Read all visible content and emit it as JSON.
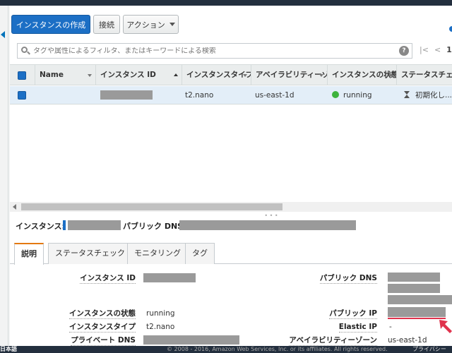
{
  "toolbar": {
    "create_instance": "インスタンスの作成",
    "connect": "接続",
    "actions": "アクション"
  },
  "search": {
    "placeholder": "タグや属性によるフィルタ、またはキーワードによる検索",
    "help": "?"
  },
  "pager": {
    "first": "|<",
    "prev": "<",
    "page": "1"
  },
  "table": {
    "columns": [
      "Name",
      "インスタンス ID",
      "インスタンスタイプ",
      "アベイラビリティーゾーン",
      "インスタンスの状態",
      "ステータスチェック"
    ],
    "rows": [
      {
        "name": "",
        "instance_id": "",
        "instance_type": "t2.nano",
        "availability_zone": "us-east-1d",
        "state": "running",
        "status_check": "初期化し..."
      }
    ]
  },
  "detail": {
    "instance_label": "インスタンス:",
    "public_dns_label": "パブリック DNS:"
  },
  "tabs": [
    "説明",
    "ステータスチェック",
    "モニタリング",
    "タグ"
  ],
  "description": {
    "instance_id_label": "インスタンス ID",
    "instance_state_label": "インスタンスの状態",
    "instance_state_value": "running",
    "instance_type_label": "インスタンスタイプ",
    "instance_type_value": "t2.nano",
    "private_dns_label": "プライベート DNS",
    "public_dns_label": "パブリック DNS",
    "public_ip_label": "パブリック IP",
    "elastic_ip_label": "Elastic IP",
    "elastic_ip_value": "-",
    "availability_zone_label": "アベイラビリティーゾーン",
    "availability_zone_value": "us-east-1d"
  },
  "footer": {
    "language": "日本語",
    "copyright": "© 2008 - 2016, Amazon Web Services, Inc. or its affiliates. All rights reserved.",
    "privacy": "プライバシー"
  },
  "colors": {
    "primary_button": "#1c6fc5",
    "running_status": "#3db33d",
    "active_tab_accent": "#e47911",
    "highlight_arrow": "#e0334d"
  }
}
